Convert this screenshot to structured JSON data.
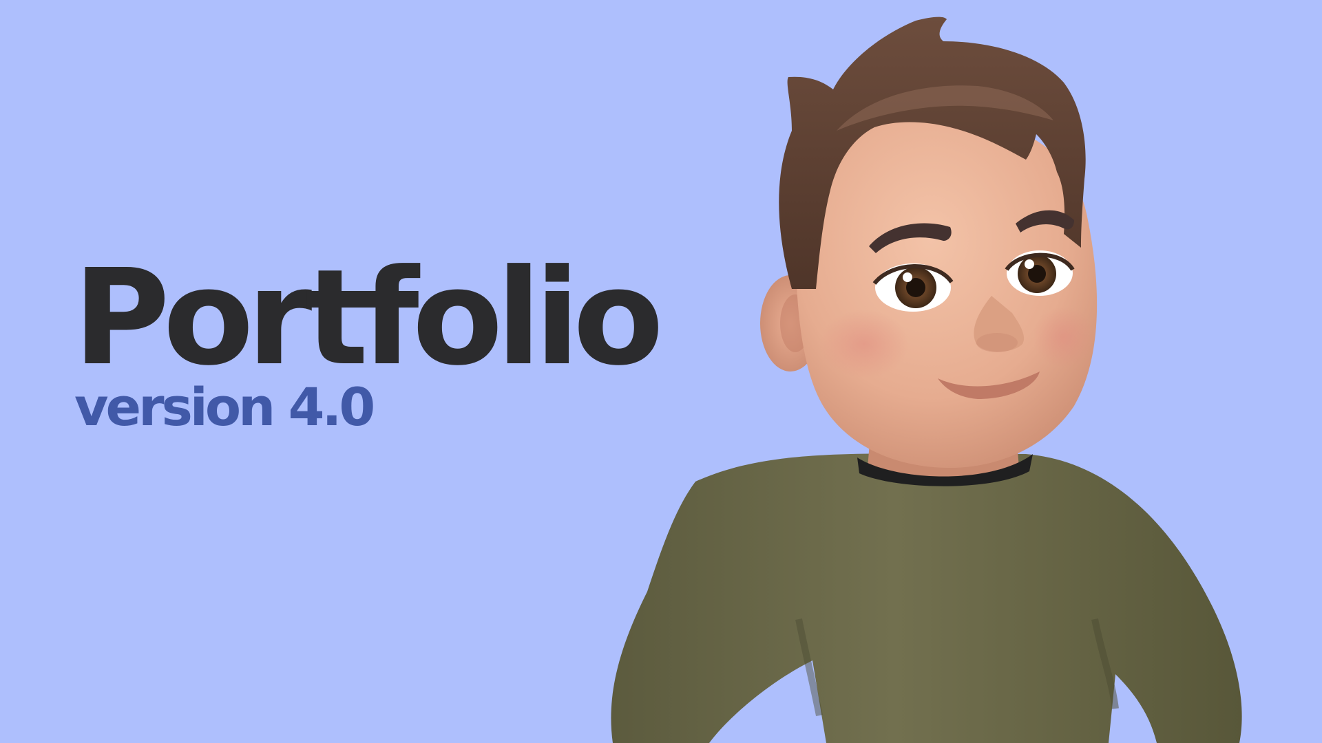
{
  "hero": {
    "title": "Portfolio",
    "subtitle": "version 4.0"
  },
  "colors": {
    "background": "#aebffd",
    "title": "#2b2b2d",
    "subtitle": "#4159a8",
    "hair": "#5e4234",
    "skin": "#ecb49a",
    "sweater": "#6c6b4b",
    "collar": "#1f1f20"
  },
  "avatar": {
    "icon": "memoji-avatar-icon"
  }
}
